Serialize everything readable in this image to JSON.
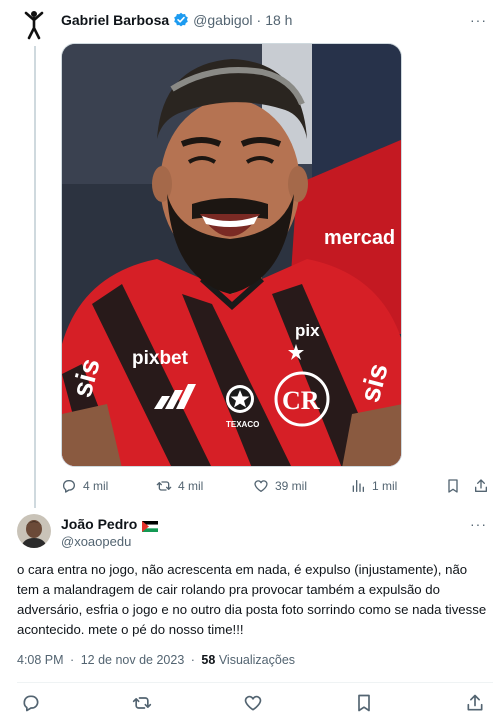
{
  "original_tweet": {
    "author_name": "Gabriel Barbosa",
    "handle": "@gabigol",
    "separator": "·",
    "time": "18 h",
    "more_label": "···",
    "photo_texts": {
      "sponsor_main": "pixbet",
      "sponsor_sleeve": "sis",
      "sponsor_chest_right": "pix",
      "sponsor_badge": "TEXACO",
      "background_banner": "mercad"
    },
    "actions": {
      "replies": "4 mil",
      "reposts": "4 mil",
      "likes": "39 mil",
      "views": "1 mil"
    }
  },
  "reply_tweet": {
    "author_name": "João Pedro",
    "handle": "@xoaopedu",
    "more_label": "···",
    "text": "o cara entra no jogo, não acrescenta em nada, é expulso (injustamente), não tem a malandragem de cair rolando pra provocar também a expulsão do adversário, esfria o jogo e no outro dia posta foto sorrindo como se nada tivesse acontecido. mete o pé do nosso time!!!",
    "time": "4:08 PM",
    "separator": "·",
    "date": "12 de nov de 2023",
    "views_count": "58",
    "views_label": "Visualizações"
  },
  "colors": {
    "text_primary": "#0f1419",
    "text_secondary": "#536471",
    "verified_blue": "#1d9bf0",
    "divider": "#eff3f4",
    "jersey_red": "#d61f26",
    "jersey_black": "#1a1a1a"
  },
  "icons": {
    "reply": "reply-icon",
    "repost": "repost-icon",
    "like": "heart-icon",
    "views": "views-icon",
    "bookmark": "bookmark-icon",
    "share": "share-icon",
    "verified": "verified-badge-icon",
    "flag": "palestine-flag-icon"
  }
}
